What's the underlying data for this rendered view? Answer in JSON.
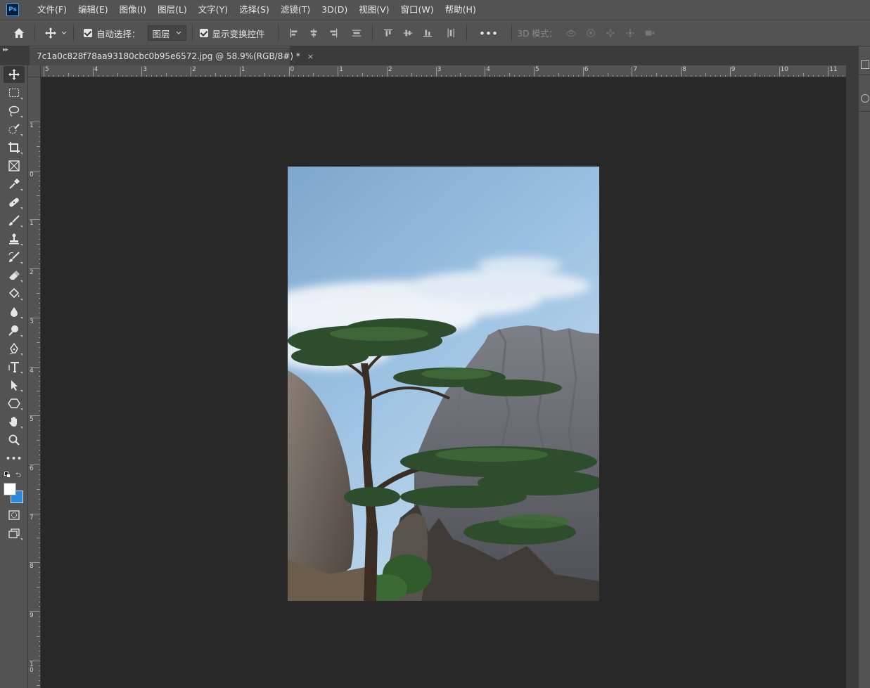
{
  "app": {
    "logo_text": "Ps",
    "menus": [
      "文件(F)",
      "编辑(E)",
      "图像(I)",
      "图层(L)",
      "文字(Y)",
      "选择(S)",
      "滤镜(T)",
      "3D(D)",
      "视图(V)",
      "窗口(W)",
      "帮助(H)"
    ]
  },
  "options": {
    "auto_select_label": "自动选择：",
    "auto_select_checked": true,
    "target_value": "图层",
    "show_transform_label": "显示变换控件",
    "show_transform_checked": true,
    "more_label": "•••",
    "mode_3d_label": "3D 模式："
  },
  "document": {
    "tab_title": "7c1a0c828f78aa93180cbc0b95e6572.jpg @ 58.9%(RGB/8#) *",
    "close_glyph": "×"
  },
  "rulers": {
    "top_labels": [
      "5",
      "4",
      "3",
      "2",
      "1",
      "0",
      "1",
      "2",
      "3",
      "4",
      "5",
      "6",
      "7",
      "8",
      "9",
      "10",
      "11"
    ],
    "left_labels": [
      "1",
      "0",
      "1",
      "2",
      "3",
      "4",
      "5",
      "6",
      "7",
      "8",
      "9",
      "10"
    ]
  },
  "toolbar": {
    "more_label": "•••",
    "tools": [
      "move-tool",
      "marquee-tool",
      "lasso-tool",
      "quick-select-tool",
      "crop-tool",
      "frame-tool",
      "eyedropper-tool",
      "healing-tool",
      "brush-tool",
      "stamp-tool",
      "history-brush-tool",
      "eraser-tool",
      "paint-bucket-tool",
      "blur-tool",
      "dodge-tool",
      "pen-tool",
      "type-tool",
      "path-select-tool",
      "shape-tool",
      "hand-tool",
      "zoom-tool"
    ]
  },
  "colors": {
    "foreground": "#ffffff",
    "background": "#2a8ae0",
    "accent": "#31a8ff"
  }
}
